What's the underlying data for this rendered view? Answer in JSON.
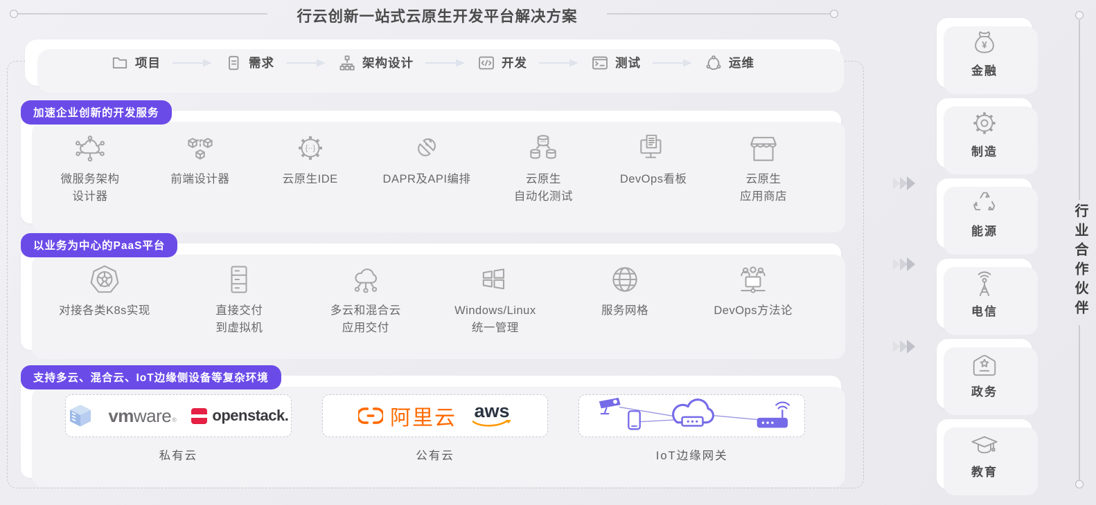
{
  "title": "行云创新一站式云原生开发平台解决方案",
  "workflow": {
    "steps": [
      {
        "label": "项目"
      },
      {
        "label": "需求"
      },
      {
        "label": "架构设计"
      },
      {
        "label": "开发"
      },
      {
        "label": "测试"
      },
      {
        "label": "运维"
      }
    ]
  },
  "sections": [
    {
      "badge": "加速企业创新的开发服务",
      "items": [
        {
          "lines": [
            "微服务架构",
            "设计器"
          ]
        },
        {
          "lines": [
            "前端设计器"
          ]
        },
        {
          "lines": [
            "云原生IDE"
          ]
        },
        {
          "lines": [
            "DAPR及API编排"
          ]
        },
        {
          "lines": [
            "云原生",
            "自动化测试"
          ]
        },
        {
          "lines": [
            "DevOps看板"
          ]
        },
        {
          "lines": [
            "云原生",
            "应用商店"
          ]
        }
      ]
    },
    {
      "badge": "以业务为中心的PaaS平台",
      "items": [
        {
          "lines": [
            "对接各类K8s实现"
          ]
        },
        {
          "lines": [
            "直接交付",
            "到虚拟机"
          ]
        },
        {
          "lines": [
            "多云和混合云",
            "应用交付"
          ]
        },
        {
          "lines": [
            "Windows/Linux",
            "统一管理"
          ]
        },
        {
          "lines": [
            "服务网格"
          ]
        },
        {
          "lines": [
            "DevOps方法论"
          ]
        }
      ]
    },
    {
      "badge": "支持多云、混合云、IoT边缘侧设备等复杂环境",
      "environments": [
        {
          "label": "私有云",
          "logos": {
            "vmware_vm": "vm",
            "vmware_ware": "ware",
            "vmware_reg": "®",
            "openstack": "openstack."
          }
        },
        {
          "label": "公有云",
          "logos": {
            "alibaba": "阿里云",
            "aws": "aws"
          }
        },
        {
          "label": "IoT边缘网关"
        }
      ]
    }
  ],
  "partners": {
    "vertical_label": "行业合作伙伴",
    "industries": [
      {
        "label": "金融"
      },
      {
        "label": "制造"
      },
      {
        "label": "能源"
      },
      {
        "label": "电信"
      },
      {
        "label": "政务"
      },
      {
        "label": "教育"
      }
    ]
  },
  "colors": {
    "badge_purple": "#6B4BE8",
    "iot_purple": "#756BE8",
    "alibaba_orange": "#FF6A00",
    "aws_smile_orange": "#FF9900",
    "aws_text_navy": "#2B3442",
    "openstack_red": "#E52044",
    "vmware_gray": "#6F6C71"
  }
}
